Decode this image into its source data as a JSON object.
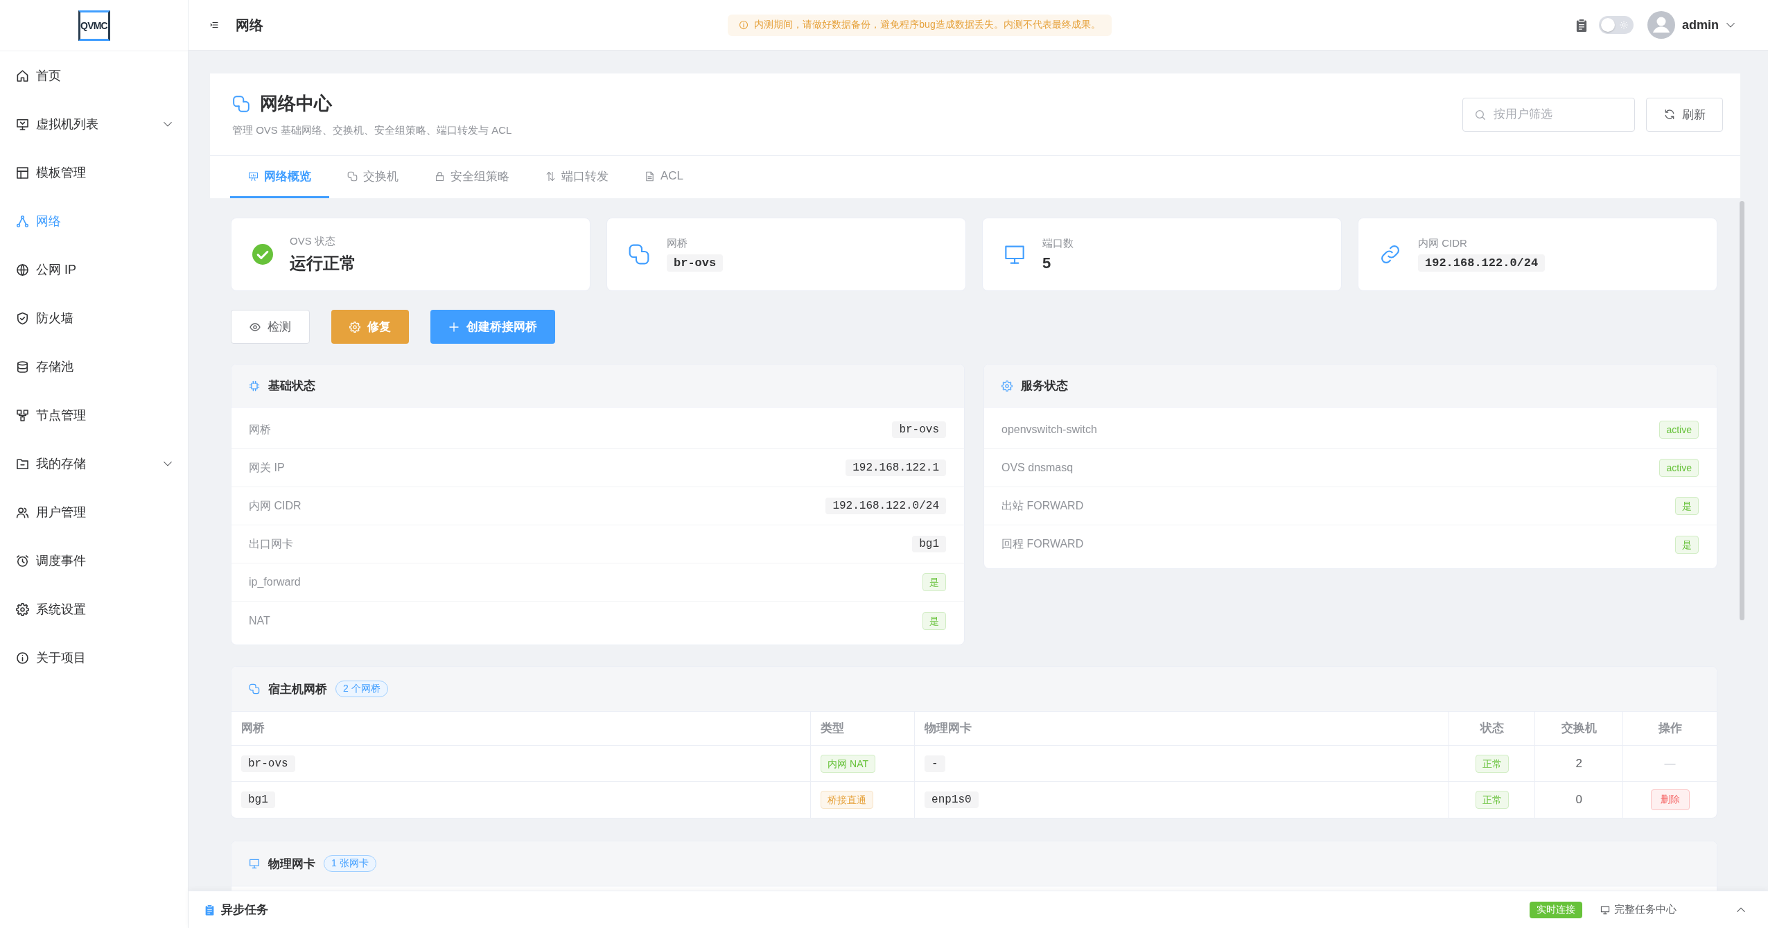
{
  "sidebar": {
    "logo": "QVMC",
    "items": [
      {
        "label": "首页",
        "kind": "link",
        "selected": false
      },
      {
        "label": "虚拟机列表",
        "kind": "submenu",
        "expanded": false,
        "selected": false
      },
      {
        "label": "模板管理",
        "kind": "link",
        "selected": false
      },
      {
        "label": "网络",
        "kind": "link",
        "selected": true
      },
      {
        "label": "公网 IP",
        "kind": "link",
        "selected": false
      },
      {
        "label": "防火墙",
        "kind": "link",
        "selected": false
      },
      {
        "label": "存储池",
        "kind": "link",
        "selected": false
      },
      {
        "label": "节点管理",
        "kind": "link",
        "selected": false
      },
      {
        "label": "我的存储",
        "kind": "submenu",
        "expanded": false,
        "selected": false
      },
      {
        "label": "用户管理",
        "kind": "link",
        "selected": false
      },
      {
        "label": "调度事件",
        "kind": "link",
        "selected": false
      },
      {
        "label": "系统设置",
        "kind": "link",
        "selected": false
      },
      {
        "label": "关于项目",
        "kind": "link",
        "selected": false
      }
    ]
  },
  "header": {
    "title": "网络",
    "notice": "内测期间，请做好数据备份，避免程序bug造成数据丢失。内测不代表最终成果。",
    "theme_switch": {
      "on": false
    },
    "user": {
      "name": "admin"
    }
  },
  "page": {
    "title": "网络中心",
    "subtitle": "管理 OVS 基础网络、交换机、安全组策略、端口转发与 ACL",
    "search": {
      "placeholder": "按用户筛选"
    },
    "refresh_button": "刷新"
  },
  "tabs": [
    {
      "label": "网络概览",
      "selected": true
    },
    {
      "label": "交换机",
      "selected": false
    },
    {
      "label": "安全组策略",
      "selected": false
    },
    {
      "label": "端口转发",
      "selected": false
    },
    {
      "label": "ACL",
      "selected": false
    }
  ],
  "stats": [
    {
      "label": "OVS 状态",
      "value": "运行正常",
      "kind": "status",
      "ok": true
    },
    {
      "label": "网桥",
      "value": "br-ovs",
      "kind": "code"
    },
    {
      "label": "端口数",
      "value": "5",
      "kind": "number"
    },
    {
      "label": "内网 CIDR",
      "value": "192.168.122.0/24",
      "kind": "code"
    }
  ],
  "actions": [
    {
      "label": "检测",
      "kind": "default"
    },
    {
      "label": "修复",
      "kind": "warning"
    },
    {
      "label": "创建桥接网桥",
      "kind": "primary"
    }
  ],
  "basic_status": {
    "title": "基础状态",
    "rows": [
      {
        "label": "网桥",
        "value": "br-ovs",
        "kind": "code"
      },
      {
        "label": "网关 IP",
        "value": "192.168.122.1",
        "kind": "code"
      },
      {
        "label": "内网 CIDR",
        "value": "192.168.122.0/24",
        "kind": "code"
      },
      {
        "label": "出口网卡",
        "value": "bg1",
        "kind": "code"
      },
      {
        "label": "ip_forward",
        "value": "是",
        "kind": "tag",
        "color": "#67c23a"
      },
      {
        "label": "NAT",
        "value": "是",
        "kind": "tag",
        "color": "#67c23a"
      }
    ]
  },
  "service_status": {
    "title": "服务状态",
    "rows": [
      {
        "label": "openvswitch-switch",
        "value": "active",
        "color": "#67c23a"
      },
      {
        "label": "OVS dnsmasq",
        "value": "active",
        "color": "#67c23a"
      },
      {
        "label": "出站 FORWARD",
        "value": "是",
        "color": "#67c23a"
      },
      {
        "label": "回程 FORWARD",
        "value": "是",
        "color": "#67c23a"
      }
    ]
  },
  "host_bridges": {
    "title": "宿主机网桥",
    "count_badge": "2 个网桥",
    "columns": [
      "网桥",
      "类型",
      "物理网卡",
      "状态",
      "交换机",
      "操作"
    ],
    "rows": [
      {
        "bridge": "br-ovs",
        "type": {
          "label": "内网 NAT",
          "color": "#67c23a"
        },
        "nic": "-",
        "status": {
          "label": "正常",
          "color": "#67c23a"
        },
        "switches": "2",
        "action": {
          "kind": "none",
          "label": "—"
        }
      },
      {
        "bridge": "bg1",
        "type": {
          "label": "桥接直通",
          "color": "#e6a23c"
        },
        "nic": "enp1s0",
        "status": {
          "label": "正常",
          "color": "#67c23a"
        },
        "switches": "0",
        "action": {
          "kind": "delete",
          "label": "删除"
        }
      }
    ]
  },
  "physical_nics": {
    "title": "物理网卡",
    "count_badge": "1 张网卡"
  },
  "bottom_bar": {
    "title": "异步任务",
    "connection": {
      "label": "实时连接",
      "connected": true
    },
    "task_center_link": "完整任务中心",
    "expanded": false
  }
}
